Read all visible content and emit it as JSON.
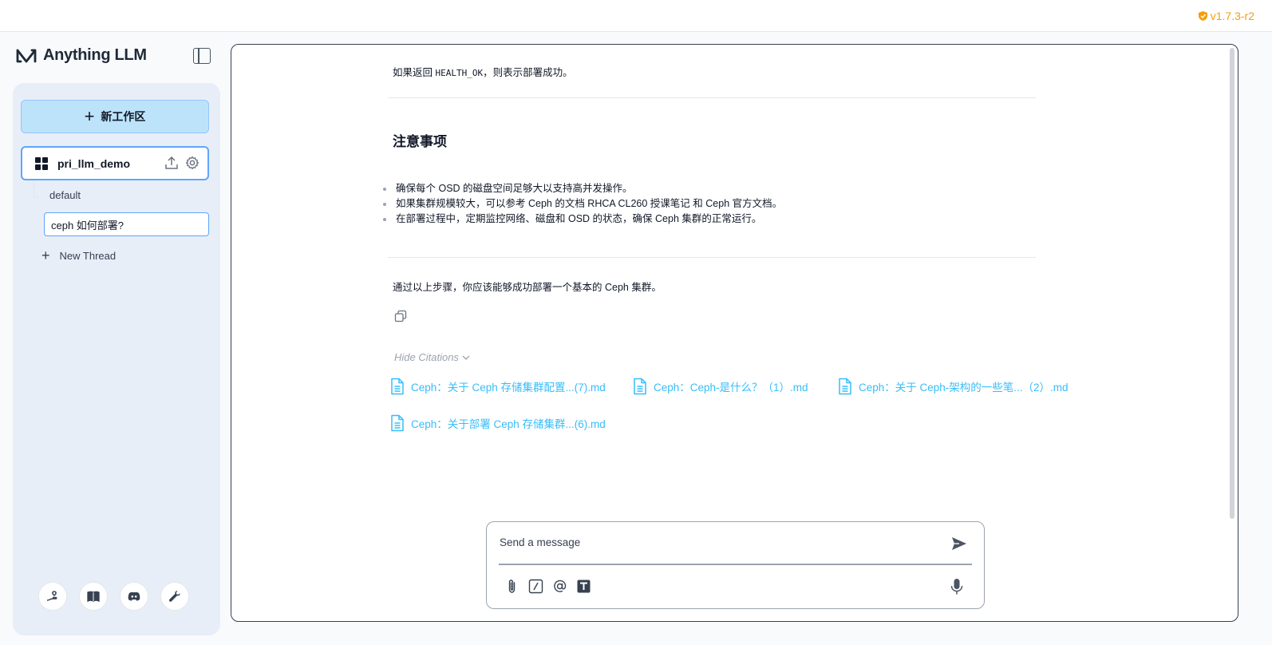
{
  "app": {
    "logo_text": "Anything LLM",
    "version": "v1.7.3-r2",
    "colors": {
      "accent": "#38bdf8",
      "version": "#f59e0b",
      "new_workspace_bg": "#bde3fb",
      "active_border": "#60a5fa"
    }
  },
  "sidebar": {
    "new_workspace_label": "新工作区",
    "workspace": {
      "name": "pri_llm_demo",
      "icons": [
        "upload-icon",
        "gear-icon"
      ]
    },
    "threads": [
      {
        "label": "default"
      },
      {
        "label": "ceph 如何部署?"
      }
    ],
    "new_thread_label": "New Thread",
    "footer_icons": [
      "support-icon",
      "docs-book-icon",
      "discord-icon",
      "wrench-icon"
    ]
  },
  "chat": {
    "health_line": {
      "prefix": "如果返回 ",
      "code": "HEALTH_OK",
      "suffix": "，则表示部署成功。"
    },
    "heading": "注意事项",
    "bullets": [
      "确保每个 OSD 的磁盘空间足够大以支持高并发操作。",
      "如果集群规模较大，可以参考 Ceph 的文档 RHCA CL260 授课笔记 和 Ceph 官方文档。",
      "在部署过程中，定期监控网络、磁盘和 OSD 的状态，确保 Ceph 集群的正常运行。"
    ],
    "conclusion": "通过以上步骤，你应该能够成功部署一个基本的 Ceph 集群。",
    "hide_citations_label": "Hide Citations",
    "citations": [
      "Ceph：关于 Ceph 存储集群配置...(7).md",
      "Ceph：Ceph-是什么？（1）.md",
      "Ceph：关于 Ceph-架构的一些笔...（2）.md",
      "Ceph：关于部署 Ceph 存储集群...(6).md"
    ]
  },
  "composer": {
    "placeholder": "Send a message",
    "tools": [
      "paperclip-icon",
      "slash-command-icon",
      "at-mention-icon",
      "text-size-icon"
    ]
  }
}
